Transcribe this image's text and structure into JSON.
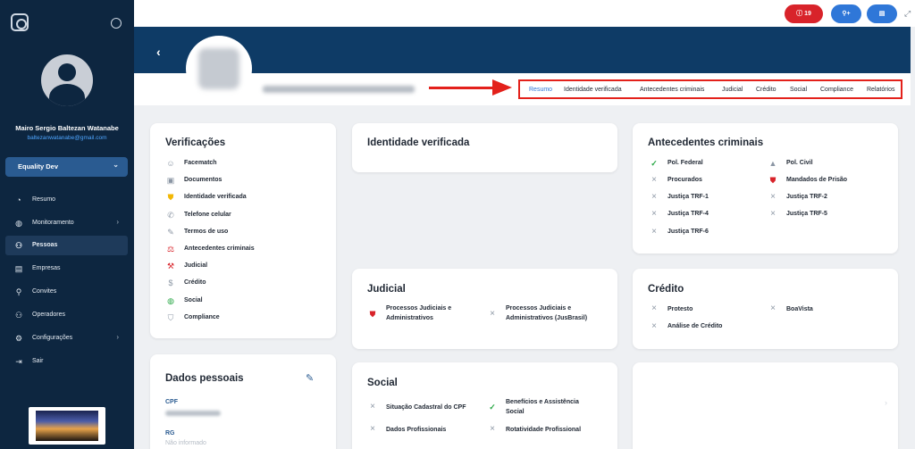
{
  "sidebar": {
    "user_name": "Mairo Sergio Baltezan Watanabe",
    "user_email": "baltezanwatanabe@gmail.com",
    "org": "Equality Dev",
    "nav": [
      {
        "label": "Resumo",
        "icon": "chart-pie-icon",
        "glyph": "◔"
      },
      {
        "label": "Monitoramento",
        "icon": "globe-icon",
        "glyph": "◍"
      },
      {
        "label": "Pessoas",
        "icon": "people-icon",
        "glyph": "⚇"
      },
      {
        "label": "Empresas",
        "icon": "building-icon",
        "glyph": "▤"
      },
      {
        "label": "Convites",
        "icon": "add-user-icon",
        "glyph": "⚲"
      },
      {
        "label": "Operadores",
        "icon": "operators-icon",
        "glyph": "⚇"
      },
      {
        "label": "Configurações",
        "icon": "gear-icon",
        "glyph": "⚙"
      },
      {
        "label": "Sair",
        "icon": "logout-icon",
        "glyph": "⇥"
      }
    ]
  },
  "topbar": {
    "alert_count": "19"
  },
  "tabs": [
    "Resumo",
    "Identidade verificada",
    "Antecedentes criminais",
    "Judicial",
    "Crédito",
    "Social",
    "Compliance",
    "Relatórios"
  ],
  "verificacoes": {
    "title": "Verificações",
    "items": [
      "Facematch",
      "Documentos",
      "Identidade verificada",
      "Telefone celular",
      "Termos de uso",
      "Antecedentes criminais",
      "Judicial",
      "Crédito",
      "Social",
      "Compliance"
    ]
  },
  "dados_pessoais": {
    "title": "Dados pessoais",
    "cpf_label": "CPF",
    "rg_label": "RG",
    "rg_value": "Não informado"
  },
  "identidade": {
    "title": "Identidade verificada"
  },
  "antecedentes": {
    "title": "Antecedentes criminais",
    "left": [
      "Pol. Federal",
      "Procurados",
      "Justiça TRF-1",
      "Justiça TRF-4",
      "Justiça TRF-6"
    ],
    "right": [
      "Pol. Civil",
      "Mandados de Prisão",
      "Justiça TRF-2",
      "Justiça TRF-5"
    ]
  },
  "judicial": {
    "title": "Judicial",
    "item1_line1": "Processos Judiciais e",
    "item1_line2": "Administrativos",
    "item2_line1": "Processos Judiciais e",
    "item2_line2": "Administrativos (JusBrasil)"
  },
  "credito": {
    "title": "Crédito",
    "items": [
      "Protesto",
      "BoaVista",
      "Análise de Crédito"
    ]
  },
  "social": {
    "title": "Social",
    "item1": "Situação Cadastral do CPF",
    "item2_line1": "Benefícios e Assistência",
    "item2_line2": "Social",
    "item3": "Dados Profissionais",
    "item4": "Rotatividade Profissional"
  }
}
